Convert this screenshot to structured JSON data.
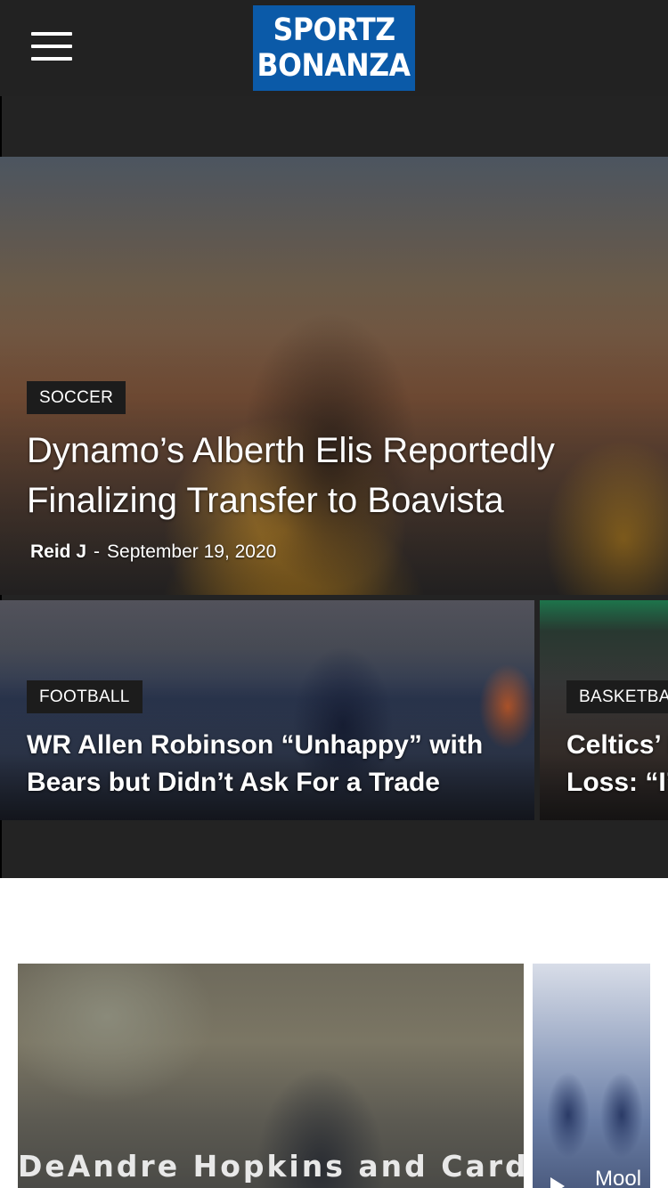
{
  "header": {
    "logo_line1": "SPORTZ",
    "logo_line2": "BONANZA",
    "menu_icon": "hamburger-menu-icon",
    "logo_color": "#0b5aa8",
    "background": "#222222"
  },
  "featured": {
    "category": "SOCCER",
    "title": "Dynamo’s Alberth Elis Reportedly Finalizing Transfer to Boavista",
    "author": "Reid J",
    "separator": "-",
    "date": "September 19, 2020"
  },
  "secondary": [
    {
      "category": "FOOTBALL",
      "title": "WR Allen Robinson “Unhappy” with Bears but Didn’t Ask For a Trade"
    },
    {
      "category": "BASKETBA",
      "title_line1": "Celtics’ I",
      "title_line2": "Loss: “I’"
    }
  ],
  "bottom_cards": [
    {
      "title": "DeAndre Hopkins and Cardinals"
    },
    {
      "title": "Mool",
      "play_icon": "play-icon"
    }
  ]
}
